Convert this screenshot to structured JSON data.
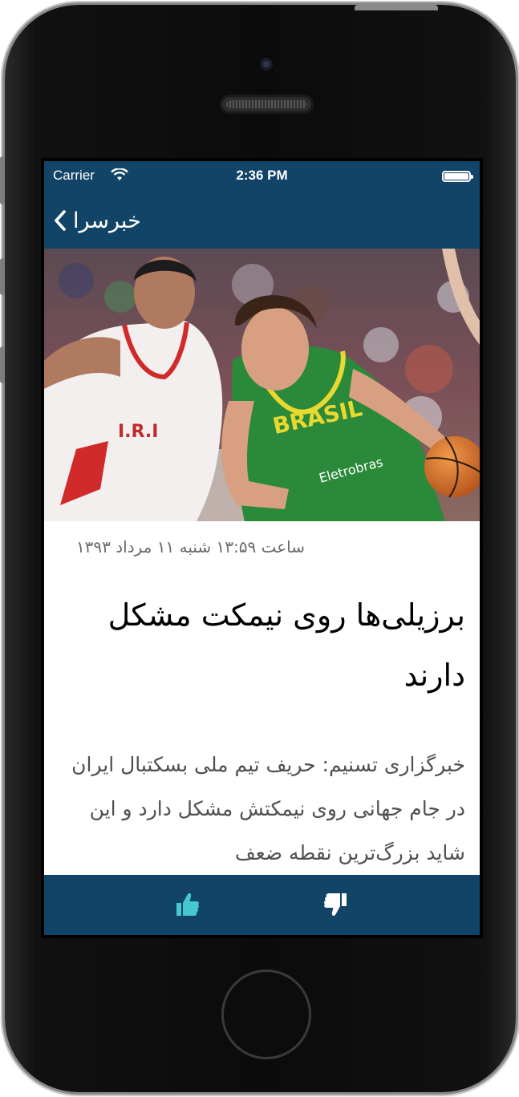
{
  "status_bar": {
    "carrier": "Carrier",
    "time": "2:36 PM"
  },
  "nav": {
    "back_label": "خبرسرا"
  },
  "article": {
    "photo_description": "",
    "date": "ساعت ۱۳:۵۹ شنبه ۱۱ مرداد ۱۳۹۳",
    "headline": "برزیلی‌ها روی نیمکت مشکل دارند",
    "body": "خبرگزاری تسنیم: حریف تیم ملی بسکتبال ایران در جام جهانی روی نیمکتش مشکل دارد و این شاید بزرگ‌ترین نقطه ضعف"
  },
  "photo_text": {
    "left_jersey": "I.R.I",
    "right_jersey": "BRASIL",
    "sponsor": "Eletrobras"
  },
  "toolbar": {
    "like_icon": "thumbs-up-icon",
    "dislike_icon": "thumbs-down-icon"
  },
  "colors": {
    "bar": "#124468",
    "accent": "#45c8d0"
  }
}
